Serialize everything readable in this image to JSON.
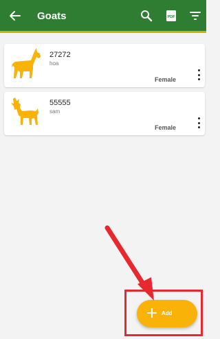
{
  "header": {
    "title": "Goats",
    "back_icon": "arrow-left-icon",
    "actions": [
      "search-icon",
      "pdf-icon",
      "filter-icon"
    ],
    "pdf_badge": "PDF",
    "colors": {
      "bar": "#2e7d32",
      "underline": "#c8b400",
      "text": "#ffffff"
    }
  },
  "goats": [
    {
      "tag": "27272",
      "name": "hoa",
      "sex": "Female",
      "icon": "goat-icon"
    },
    {
      "tag": "55555",
      "name": "sam",
      "sex": "Female",
      "icon": "goat-icon"
    }
  ],
  "fab": {
    "label": "Add",
    "icon": "plus-icon",
    "color": "#f9b208"
  },
  "annotation": {
    "color": "#e8282f"
  }
}
